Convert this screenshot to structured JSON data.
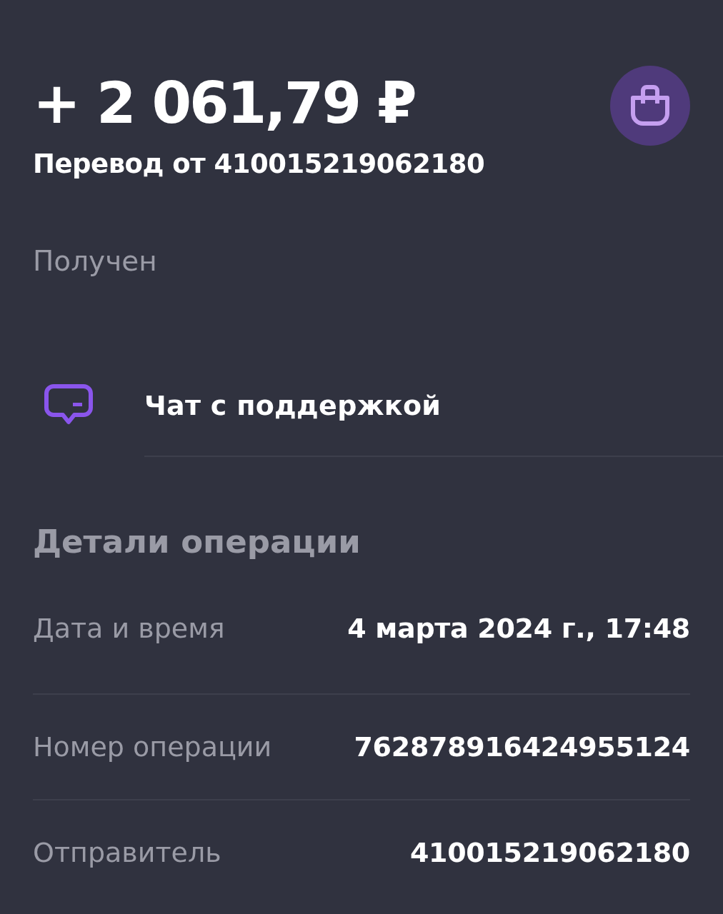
{
  "amount": "+ 2 061,79 ₽",
  "title": "Перевод от 410015219062180",
  "status": "Получен",
  "support": {
    "label": "Чат с поддержкой"
  },
  "details": {
    "heading": "Детали операции",
    "rows": [
      {
        "label": "Дата и время",
        "value": "4 марта 2024 г., 17:48"
      },
      {
        "label": "Номер операции",
        "value": "762878916424955124"
      },
      {
        "label": "Отправитель",
        "value": "410015219062180"
      }
    ]
  }
}
